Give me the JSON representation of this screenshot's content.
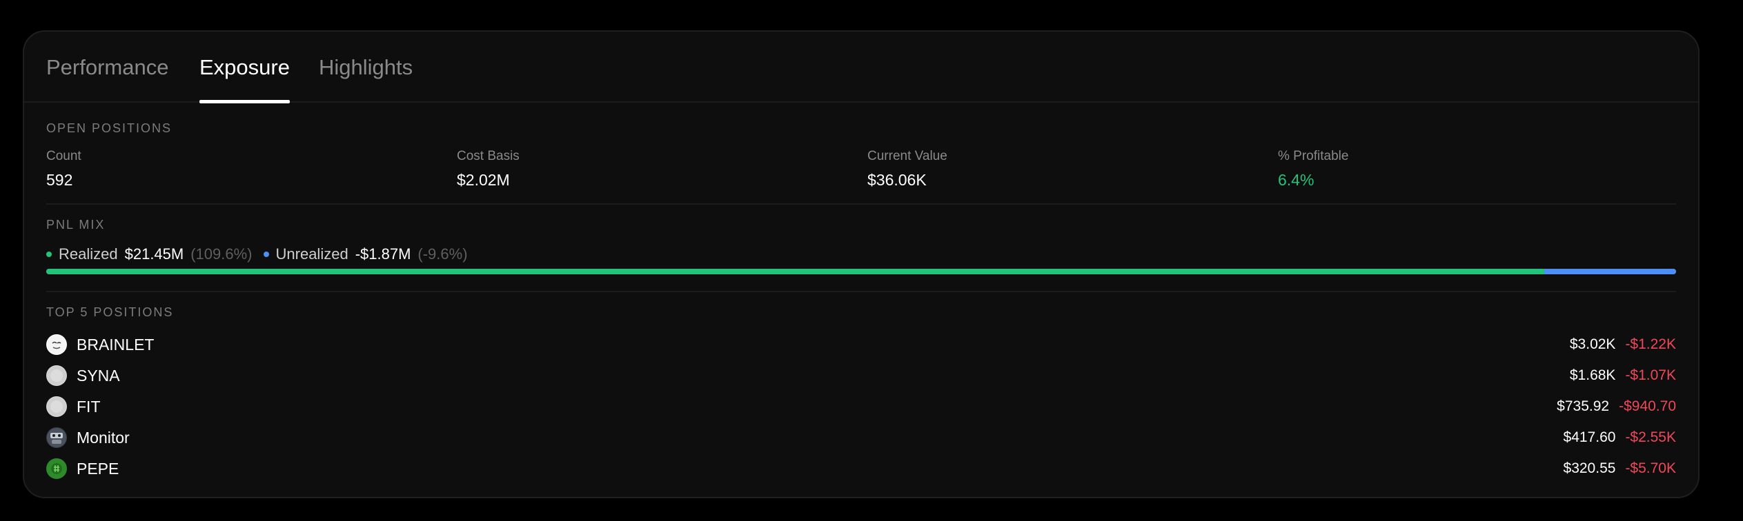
{
  "tabs": [
    {
      "label": "Performance",
      "active": false
    },
    {
      "label": "Exposure",
      "active": true
    },
    {
      "label": "Highlights",
      "active": false
    }
  ],
  "open_positions": {
    "title": "OPEN POSITIONS",
    "stats": [
      {
        "label": "Count",
        "value": "592"
      },
      {
        "label": "Cost Basis",
        "value": "$2.02M"
      },
      {
        "label": "Current Value",
        "value": "$36.06K"
      },
      {
        "label": "% Profitable",
        "value": "6.4%"
      }
    ]
  },
  "pnl_mix": {
    "title": "PNL MIX",
    "realized": {
      "label": "Realized",
      "amount": "$21.45M",
      "pct": "(109.6%)",
      "color": "#22c37a"
    },
    "unrealized": {
      "label": "Unrealized",
      "amount": "-$1.87M",
      "pct": "(-9.6%)",
      "color": "#4e8ef7"
    },
    "bar_realized_share": 0.919
  },
  "top_positions": {
    "title": "TOP 5 POSITIONS",
    "items": [
      {
        "name": "BRAINLET",
        "value": "$3.02K",
        "pnl": "-$1.22K",
        "icon": "brainlet-token-icon"
      },
      {
        "name": "SYNA",
        "value": "$1.68K",
        "pnl": "-$1.07K",
        "icon": "syna-token-icon"
      },
      {
        "name": "FIT",
        "value": "$735.92",
        "pnl": "-$940.70",
        "icon": "fit-token-icon"
      },
      {
        "name": "Monitor",
        "value": "$417.60",
        "pnl": "-$2.55K",
        "icon": "monitor-token-icon"
      },
      {
        "name": "PEPE",
        "value": "$320.55",
        "pnl": "-$5.70K",
        "icon": "pepe-token-icon"
      }
    ]
  },
  "colors": {
    "positive": "#22c37a",
    "negative": "#f0485a",
    "unrealized": "#4e8ef7"
  }
}
